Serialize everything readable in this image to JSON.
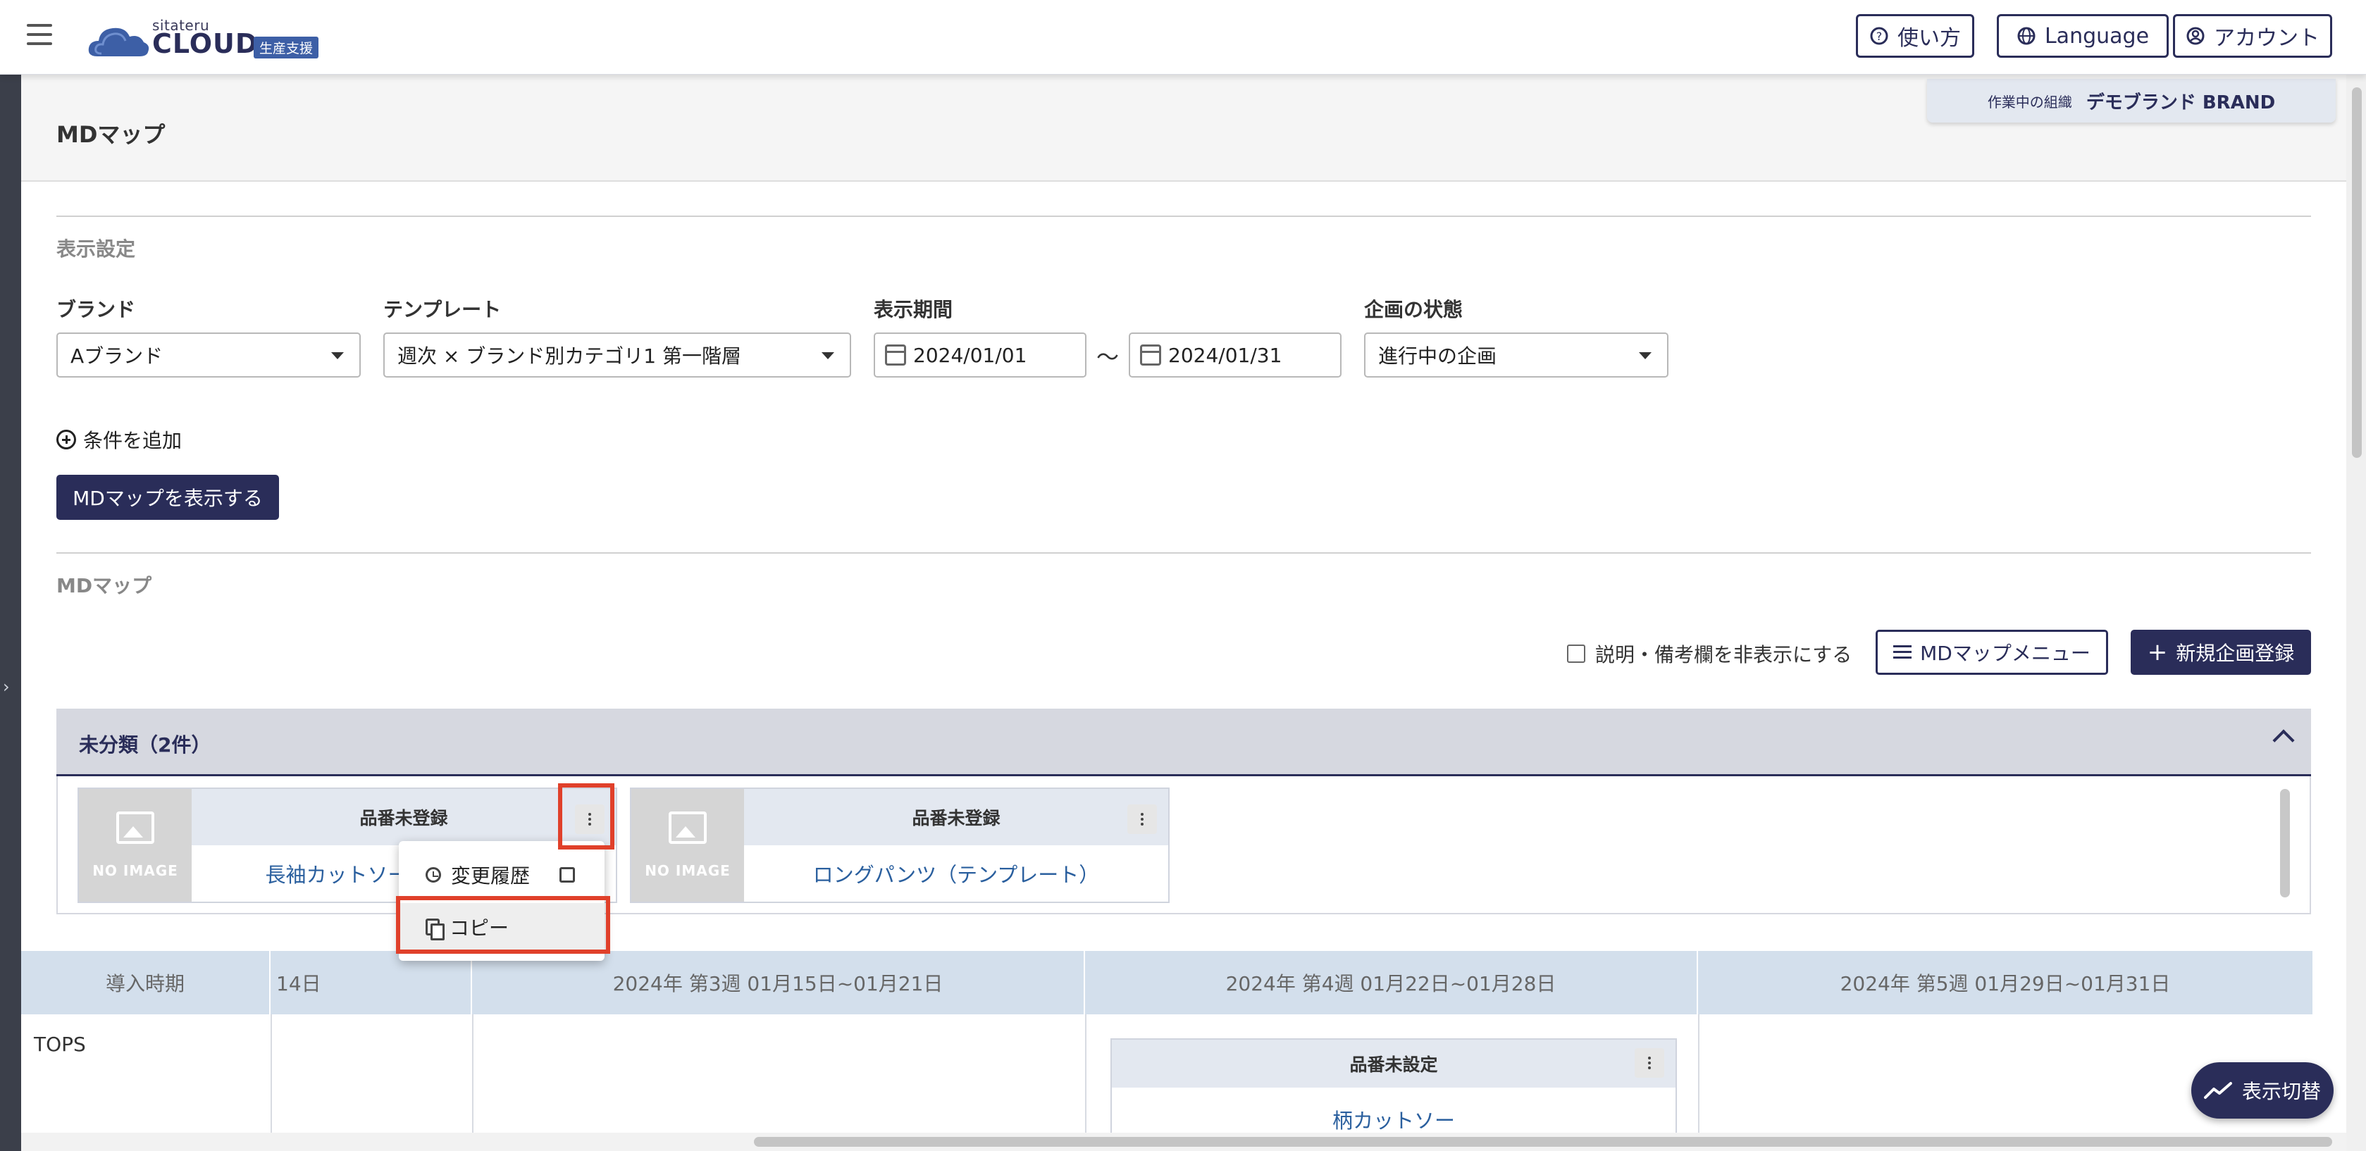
{
  "header": {
    "logo_sub": "sitateru",
    "logo_main": "CLOUD",
    "logo_badge": "生産支援",
    "help_label": "使い方",
    "language_label": "Language",
    "account_label": "アカウント"
  },
  "org": {
    "label": "作業中の組織",
    "value": "デモブランド BRAND"
  },
  "page": {
    "title": "MDマップ"
  },
  "display_settings": {
    "section_label": "表示設定",
    "brand_label": "ブランド",
    "brand_value": "Aブランド",
    "template_label": "テンプレート",
    "template_value": "週次 × ブランド別カテゴリ1 第一階層",
    "period_label": "表示期間",
    "period_start": "2024/01/01",
    "period_sep": "〜",
    "period_end": "2024/01/31",
    "status_label": "企画の状態",
    "status_value": "進行中の企画",
    "add_condition_label": "条件を追加",
    "show_button_label": "MDマップを表示する"
  },
  "mdmap": {
    "section_label": "MDマップ",
    "hide_notes_label": "説明・備考欄を非表示にする",
    "hide_notes_checked": false,
    "menu_button_label": "MDマップメニュー",
    "new_button_label": "新規企画登録"
  },
  "unclassified": {
    "title": "未分類（2件）",
    "cards": [
      {
        "code": "品番未登録",
        "image_label": "NO IMAGE",
        "name": "長袖カットソー"
      },
      {
        "code": "品番未登録",
        "image_label": "NO IMAGE",
        "name": "ロングパンツ（テンプレート）"
      }
    ]
  },
  "context_menu": {
    "history_label": "変更履歴",
    "copy_label": "コピー"
  },
  "calendar": {
    "headers": [
      "導入時期",
      "14日",
      "2024年 第3週 01月15日~01月21日",
      "2024年 第4週 01月22日~01月28日",
      "2024年 第5週 01月29日~01月31日"
    ],
    "row_label": "TOPS",
    "card": {
      "code": "品番未設定",
      "name": "柄カットソー"
    }
  },
  "fab": {
    "label": "表示切替"
  },
  "colors": {
    "primary": "#2a2d59",
    "link": "#2a5f9e",
    "highlight": "#e0402a",
    "header_tint": "#d3dfec"
  }
}
